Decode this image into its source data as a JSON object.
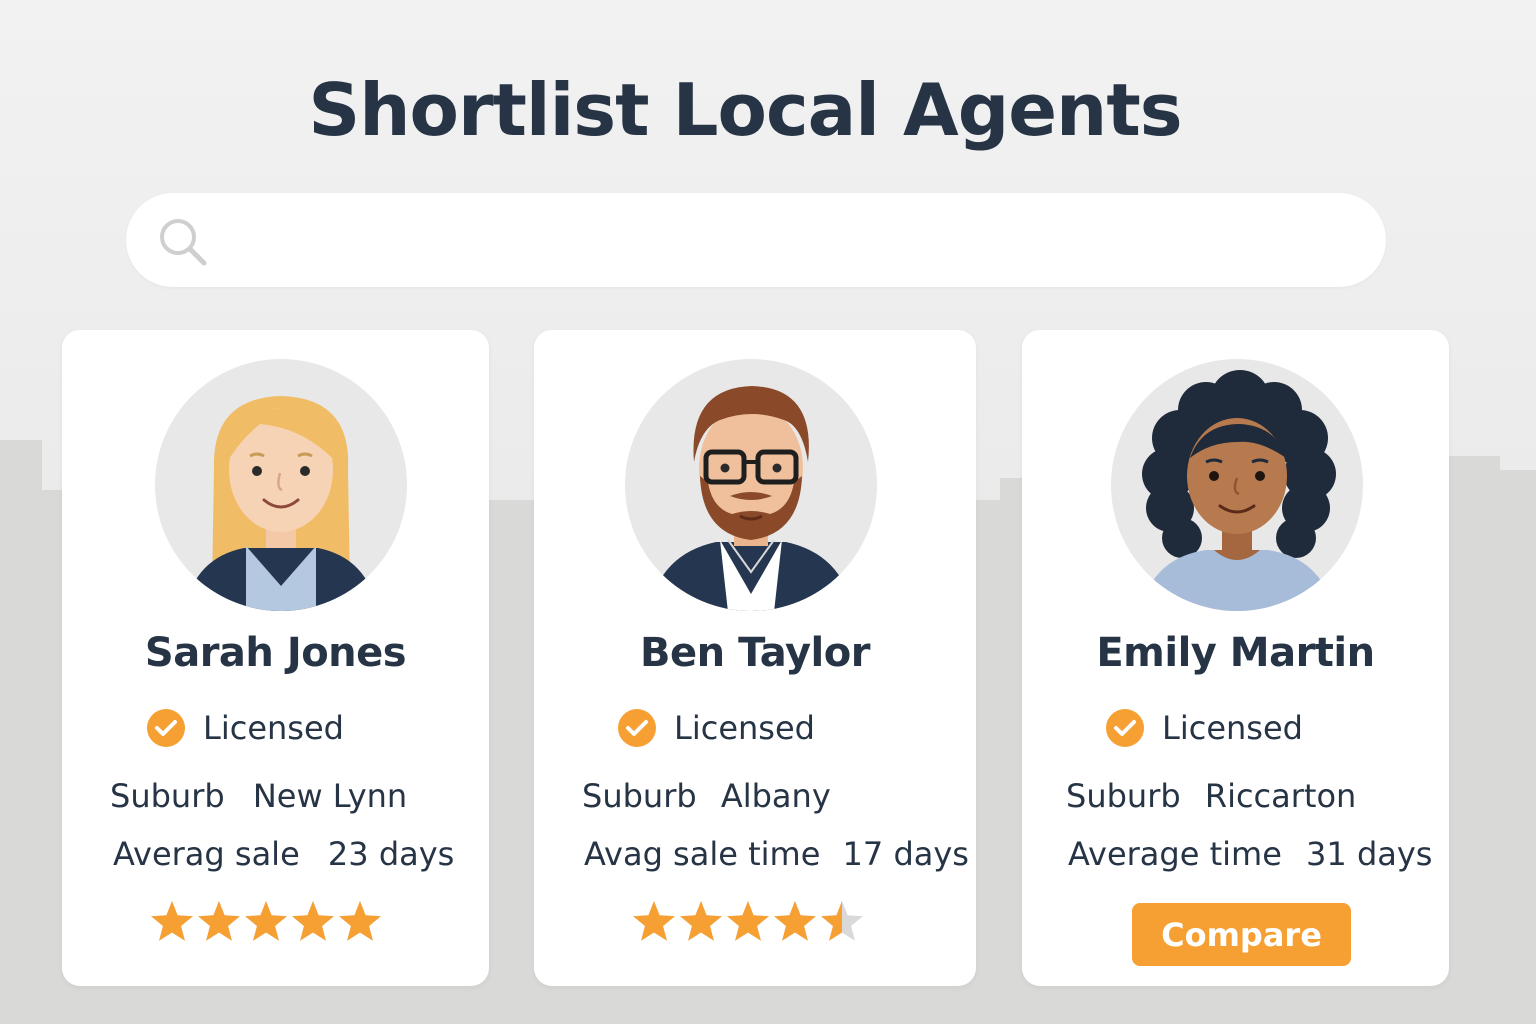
{
  "page": {
    "title": "Shortlist Local Agents"
  },
  "search": {
    "placeholder": "",
    "icon": "search-icon"
  },
  "colors": {
    "accent": "#f6a033",
    "star": "#f6a033",
    "text": "#263445",
    "card": "#ffffff"
  },
  "agents": [
    {
      "name": "Sarah Jones",
      "licensed_label": "Licensed",
      "suburb_label": "Suburb",
      "suburb": "New Lynn",
      "time_label": "Averag sale",
      "time_value": "23 days",
      "rating": 5,
      "rating_max": 5
    },
    {
      "name": "Ben Taylor",
      "licensed_label": "Licensed",
      "suburb_label": "Suburb",
      "suburb": "Albany",
      "time_label": "Avag sale time",
      "time_value": "17 days",
      "rating": 4.5,
      "rating_max": 5
    },
    {
      "name": "Emily Martin",
      "licensed_label": "Licensed",
      "suburb_label": "Suburb",
      "suburb": "Riccarton",
      "time_label": "Average time",
      "time_value": "31 days",
      "action_label": "Compare"
    }
  ]
}
